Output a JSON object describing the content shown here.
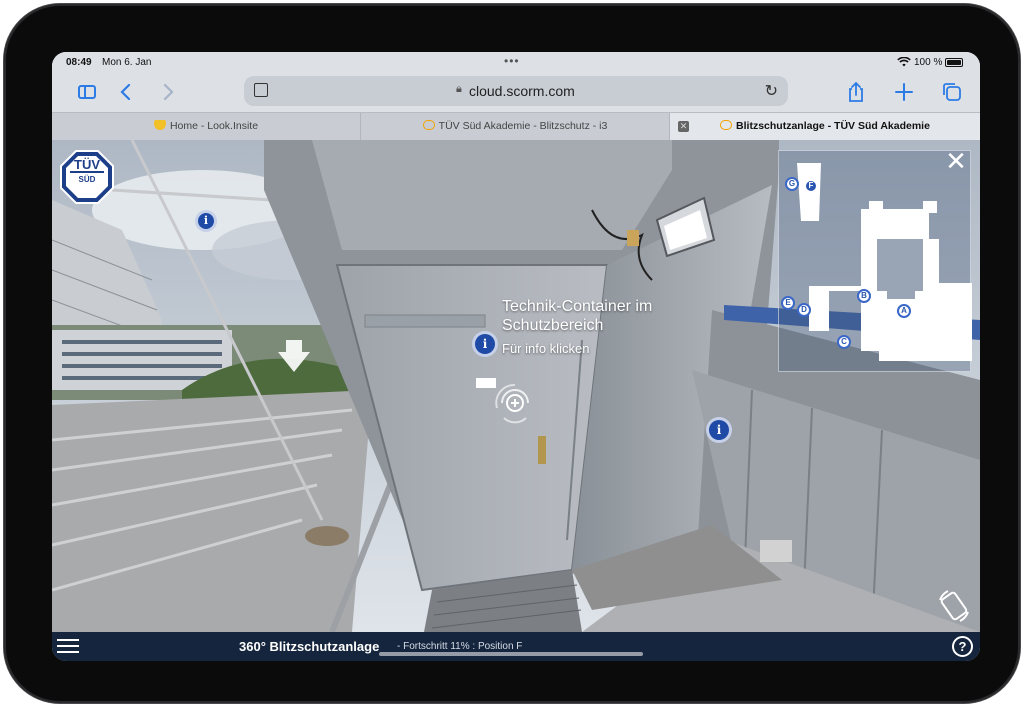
{
  "status_bar": {
    "time": "08:49",
    "date": "Mon 6. Jan",
    "battery": "100 %"
  },
  "toolbar": {
    "url": "cloud.scorm.com",
    "accent_color": "#2d7be5"
  },
  "tabs": [
    {
      "label": "Home - Look.Insite",
      "icon": "shield-favicon"
    },
    {
      "label": "TÜV Süd Akademie - Blitzschutz - i3",
      "icon": "cloud-favicon"
    },
    {
      "label": "Blitzschutzanlage - TÜV Süd Akademie",
      "icon": "cloud-favicon",
      "active": true
    }
  ],
  "tab_close_glyph": "✕",
  "pano": {
    "logo_text_top": "TÜV",
    "logo_text_bottom": "SÜD",
    "hotspot_glyph": "i",
    "hotspot_title_line1": "Technik-Container im",
    "hotspot_title_line2": "Schutzbereich",
    "hotspot_hint": "Für info klicken",
    "close_glyph": "✕",
    "hotspot_color": "#1f4aa6"
  },
  "minimap": {
    "markers": [
      "G",
      "F",
      "E",
      "D",
      "B",
      "A",
      "C"
    ],
    "current": "F"
  },
  "bottom_bar": {
    "title": "360° Blitzschutzanlage",
    "progress_text": "- Fortschritt 11% : Position F",
    "help_glyph": "?",
    "background": "#15253d"
  }
}
